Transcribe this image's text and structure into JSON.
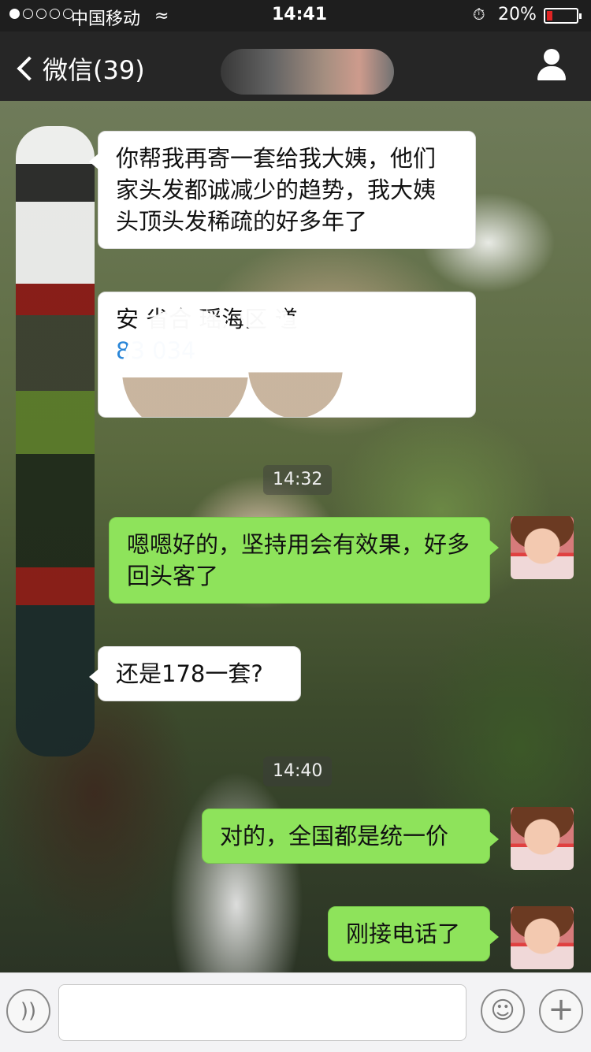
{
  "status_bar": {
    "carrier": "中国移动",
    "time": "14:41",
    "battery_percent_label": "20%",
    "battery_level": 0.2,
    "signal_strength": 1,
    "icons": [
      "signal-dots-icon",
      "wifi-icon",
      "alarm-icon",
      "battery-icon"
    ]
  },
  "nav": {
    "back_label": "微信(39)",
    "title": "",
    "right_icon": "profile-icon"
  },
  "messages": [
    {
      "side": "incoming",
      "text": "你帮我再寄一套给我大姨，他们家头发都诚减少的趋势，我大姨头顶头发稀疏的好多年了"
    },
    {
      "side": "incoming",
      "line1": "安  省合        瑶海区         道",
      "line2": "        ",
      "line3": "  83            034"
    },
    {
      "side": "outgoing",
      "text": "嗯嗯好的，坚持用会有效果，好多回头客了"
    },
    {
      "side": "incoming",
      "text": "还是178一套?"
    },
    {
      "side": "outgoing",
      "text": "对的，全国都是统一价"
    },
    {
      "side": "outgoing",
      "text": "刚接电话了"
    }
  ],
  "timestamps": [
    "14:32",
    "14:40"
  ],
  "input_bar": {
    "placeholder": "",
    "left_icon": "voice-icon",
    "emoji_icon": "emoji-icon",
    "plus_icon": "plus-icon"
  },
  "colors": {
    "outgoing_bubble": "#8ee35b",
    "incoming_bubble": "#ffffff",
    "nav_background": "#262626",
    "link_blue": "#2a86d8",
    "battery_low": "#e02424"
  }
}
